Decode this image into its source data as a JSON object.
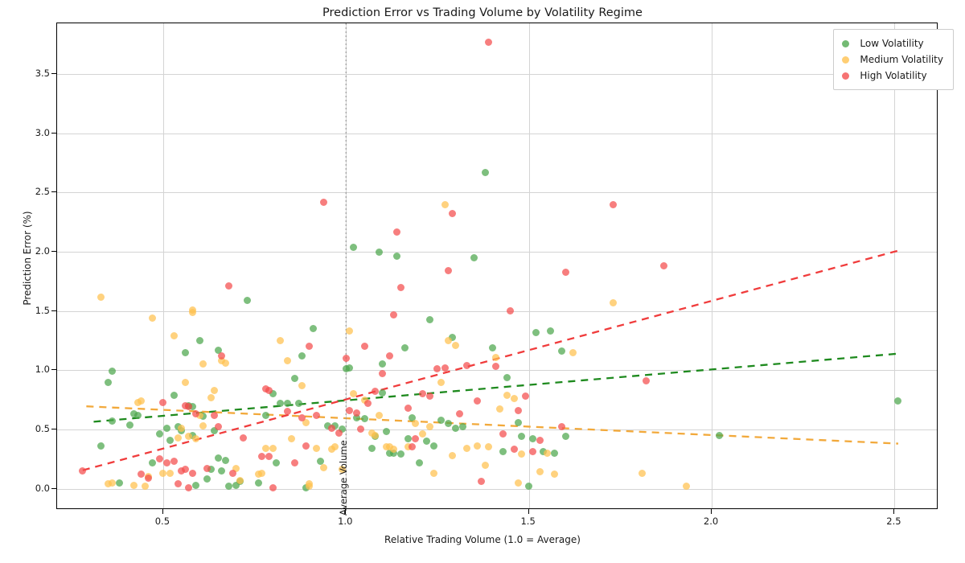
{
  "chart_data": {
    "type": "scatter",
    "title": "Prediction Error vs Trading Volume by Volatility Regime",
    "xlabel": "Relative Trading Volume (1.0 = Average)",
    "ylabel": "Prediction Error (%)",
    "xlim": [
      0.21,
      2.62
    ],
    "ylim": [
      -0.18,
      3.93
    ],
    "xticks": [
      0.5,
      1.0,
      1.5,
      2.0,
      2.5
    ],
    "xtick_labels": [
      "0.5",
      "1.0",
      "1.5",
      "2.0",
      "2.5"
    ],
    "yticks": [
      0.0,
      0.5,
      1.0,
      1.5,
      2.0,
      2.5,
      3.0,
      3.5
    ],
    "ytick_labels": [
      "0.0",
      "0.5",
      "1.0",
      "1.5",
      "2.0",
      "2.5",
      "3.0",
      "3.5"
    ],
    "grid": true,
    "legend_position": "upper right",
    "marker_opacity": 0.72,
    "annotations": [
      {
        "name": "average-volume-line",
        "text": "Average Volume",
        "x": 1.0,
        "style": "vertical dashed",
        "color": "#999999"
      }
    ],
    "colors": {
      "low": "#4CA64C",
      "medium": "#FFC04D",
      "high": "#F44C4C"
    },
    "trend_colors": {
      "low": "#1E8A1E",
      "medium": "#F2A93B",
      "high": "#F03C3C"
    },
    "series": [
      {
        "name": "Low Volatility",
        "color": "#4CA64C",
        "trendline": {
          "x": [
            0.31,
            2.51
          ],
          "y": [
            0.565,
            1.14
          ],
          "style": "dashed",
          "color": "#1E8A1E"
        },
        "points": [
          [
            0.33,
            0.36
          ],
          [
            0.35,
            0.9
          ],
          [
            0.36,
            0.99
          ],
          [
            0.36,
            0.57
          ],
          [
            0.38,
            0.05
          ],
          [
            0.41,
            0.54
          ],
          [
            0.42,
            0.63
          ],
          [
            0.43,
            0.62
          ],
          [
            0.47,
            0.22
          ],
          [
            0.49,
            0.46
          ],
          [
            0.51,
            0.51
          ],
          [
            0.52,
            0.41
          ],
          [
            0.53,
            0.79
          ],
          [
            0.54,
            0.52
          ],
          [
            0.55,
            0.49
          ],
          [
            0.56,
            1.15
          ],
          [
            0.57,
            0.7
          ],
          [
            0.58,
            0.69
          ],
          [
            0.58,
            0.45
          ],
          [
            0.59,
            0.03
          ],
          [
            0.6,
            1.25
          ],
          [
            0.61,
            0.61
          ],
          [
            0.62,
            0.08
          ],
          [
            0.63,
            0.16
          ],
          [
            0.64,
            0.49
          ],
          [
            0.65,
            1.17
          ],
          [
            0.65,
            0.26
          ],
          [
            0.66,
            0.15
          ],
          [
            0.67,
            0.24
          ],
          [
            0.68,
            0.02
          ],
          [
            0.7,
            0.03
          ],
          [
            0.71,
            0.06
          ],
          [
            0.73,
            1.59
          ],
          [
            0.76,
            0.05
          ],
          [
            0.78,
            0.62
          ],
          [
            0.8,
            0.8
          ],
          [
            0.81,
            0.22
          ],
          [
            0.82,
            0.72
          ],
          [
            0.84,
            0.72
          ],
          [
            0.86,
            0.93
          ],
          [
            0.87,
            0.72
          ],
          [
            0.88,
            1.12
          ],
          [
            0.89,
            0.01
          ],
          [
            0.91,
            1.35
          ],
          [
            0.93,
            0.23
          ],
          [
            0.95,
            0.53
          ],
          [
            0.97,
            0.53
          ],
          [
            0.99,
            0.5
          ],
          [
            1.0,
            1.01
          ],
          [
            1.01,
            1.02
          ],
          [
            1.02,
            2.04
          ],
          [
            1.03,
            0.6
          ],
          [
            1.05,
            0.59
          ],
          [
            1.07,
            0.34
          ],
          [
            1.08,
            0.44
          ],
          [
            1.09,
            2.0
          ],
          [
            1.1,
            1.05
          ],
          [
            1.1,
            0.81
          ],
          [
            1.11,
            0.48
          ],
          [
            1.12,
            0.3
          ],
          [
            1.13,
            0.3
          ],
          [
            1.14,
            1.96
          ],
          [
            1.15,
            0.29
          ],
          [
            1.16,
            1.19
          ],
          [
            1.17,
            0.42
          ],
          [
            1.18,
            0.6
          ],
          [
            1.2,
            0.22
          ],
          [
            1.22,
            0.4
          ],
          [
            1.23,
            1.43
          ],
          [
            1.24,
            0.36
          ],
          [
            1.26,
            0.58
          ],
          [
            1.28,
            0.55
          ],
          [
            1.29,
            1.28
          ],
          [
            1.3,
            0.51
          ],
          [
            1.32,
            0.52
          ],
          [
            1.35,
            1.95
          ],
          [
            1.38,
            2.67
          ],
          [
            1.4,
            1.19
          ],
          [
            1.43,
            0.31
          ],
          [
            1.44,
            0.94
          ],
          [
            1.47,
            0.56
          ],
          [
            1.48,
            0.44
          ],
          [
            1.5,
            0.02
          ],
          [
            1.51,
            0.42
          ],
          [
            1.52,
            1.32
          ],
          [
            1.54,
            0.31
          ],
          [
            1.56,
            1.33
          ],
          [
            1.57,
            0.3
          ],
          [
            1.59,
            1.16
          ],
          [
            1.6,
            0.44
          ],
          [
            2.02,
            0.45
          ],
          [
            2.51,
            0.74
          ]
        ]
      },
      {
        "name": "Medium Volatility",
        "color": "#FFC04D",
        "trendline": {
          "x": [
            0.29,
            2.51
          ],
          "y": [
            0.695,
            0.38
          ],
          "style": "dashed",
          "color": "#F2A93B"
        },
        "points": [
          [
            0.33,
            1.62
          ],
          [
            0.35,
            0.04
          ],
          [
            0.36,
            0.05
          ],
          [
            0.42,
            0.03
          ],
          [
            0.43,
            0.73
          ],
          [
            0.44,
            0.74
          ],
          [
            0.45,
            0.02
          ],
          [
            0.46,
            0.1
          ],
          [
            0.47,
            1.44
          ],
          [
            0.5,
            0.13
          ],
          [
            0.52,
            0.13
          ],
          [
            0.53,
            1.29
          ],
          [
            0.54,
            0.43
          ],
          [
            0.55,
            0.51
          ],
          [
            0.56,
            0.9
          ],
          [
            0.57,
            0.44
          ],
          [
            0.58,
            1.51
          ],
          [
            0.58,
            1.49
          ],
          [
            0.59,
            0.42
          ],
          [
            0.6,
            0.62
          ],
          [
            0.61,
            1.05
          ],
          [
            0.61,
            0.53
          ],
          [
            0.63,
            0.77
          ],
          [
            0.64,
            0.83
          ],
          [
            0.66,
            1.08
          ],
          [
            0.67,
            1.06
          ],
          [
            0.7,
            0.17
          ],
          [
            0.71,
            0.07
          ],
          [
            0.76,
            0.12
          ],
          [
            0.77,
            0.13
          ],
          [
            0.78,
            0.34
          ],
          [
            0.8,
            0.34
          ],
          [
            0.82,
            1.25
          ],
          [
            0.84,
            1.08
          ],
          [
            0.85,
            0.42
          ],
          [
            0.88,
            0.87
          ],
          [
            0.89,
            0.56
          ],
          [
            0.9,
            0.02
          ],
          [
            0.9,
            0.04
          ],
          [
            0.92,
            0.34
          ],
          [
            0.94,
            0.18
          ],
          [
            0.96,
            0.33
          ],
          [
            0.97,
            0.35
          ],
          [
            0.99,
            0.16
          ],
          [
            1.01,
            1.33
          ],
          [
            1.02,
            0.8
          ],
          [
            1.05,
            0.75
          ],
          [
            1.07,
            0.47
          ],
          [
            1.08,
            0.45
          ],
          [
            1.09,
            0.62
          ],
          [
            1.11,
            0.35
          ],
          [
            1.12,
            0.35
          ],
          [
            1.13,
            0.33
          ],
          [
            1.17,
            0.35
          ],
          [
            1.19,
            0.55
          ],
          [
            1.21,
            0.46
          ],
          [
            1.23,
            0.52
          ],
          [
            1.24,
            0.13
          ],
          [
            1.26,
            0.9
          ],
          [
            1.27,
            2.4
          ],
          [
            1.28,
            1.25
          ],
          [
            1.29,
            0.28
          ],
          [
            1.3,
            1.21
          ],
          [
            1.33,
            0.34
          ],
          [
            1.36,
            0.36
          ],
          [
            1.38,
            0.2
          ],
          [
            1.39,
            0.35
          ],
          [
            1.41,
            1.11
          ],
          [
            1.42,
            0.67
          ],
          [
            1.44,
            0.79
          ],
          [
            1.46,
            0.76
          ],
          [
            1.47,
            0.05
          ],
          [
            1.48,
            0.29
          ],
          [
            1.53,
            0.14
          ],
          [
            1.55,
            0.3
          ],
          [
            1.57,
            0.12
          ],
          [
            1.62,
            1.15
          ],
          [
            1.73,
            1.57
          ],
          [
            1.81,
            0.13
          ],
          [
            1.93,
            0.02
          ]
        ]
      },
      {
        "name": "High Volatility",
        "color": "#F44C4C",
        "trendline": {
          "x": [
            0.28,
            2.51
          ],
          "y": [
            0.155,
            2.01
          ],
          "style": "dashed",
          "color": "#F03C3C"
        },
        "points": [
          [
            0.28,
            0.15
          ],
          [
            0.44,
            0.12
          ],
          [
            0.46,
            0.09
          ],
          [
            0.49,
            0.25
          ],
          [
            0.5,
            0.73
          ],
          [
            0.51,
            0.22
          ],
          [
            0.53,
            0.23
          ],
          [
            0.54,
            0.04
          ],
          [
            0.55,
            0.15
          ],
          [
            0.56,
            0.16
          ],
          [
            0.56,
            0.7
          ],
          [
            0.57,
            0.01
          ],
          [
            0.57,
            0.69
          ],
          [
            0.58,
            0.13
          ],
          [
            0.62,
            0.17
          ],
          [
            0.65,
            0.52
          ],
          [
            0.66,
            1.12
          ],
          [
            0.68,
            1.71
          ],
          [
            0.69,
            0.13
          ],
          [
            0.72,
            0.43
          ],
          [
            0.77,
            0.27
          ],
          [
            0.78,
            0.84
          ],
          [
            0.79,
            0.83
          ],
          [
            0.79,
            0.27
          ],
          [
            0.8,
            0.01
          ],
          [
            0.84,
            0.65
          ],
          [
            0.86,
            0.22
          ],
          [
            0.88,
            0.6
          ],
          [
            0.89,
            0.36
          ],
          [
            0.9,
            1.2
          ],
          [
            0.92,
            0.62
          ],
          [
            0.94,
            2.42
          ],
          [
            0.96,
            0.51
          ],
          [
            0.98,
            0.47
          ],
          [
            1.0,
            1.1
          ],
          [
            1.01,
            0.66
          ],
          [
            1.03,
            0.64
          ],
          [
            1.05,
            1.2
          ],
          [
            1.06,
            0.72
          ],
          [
            1.08,
            0.82
          ],
          [
            1.1,
            0.97
          ],
          [
            1.12,
            1.12
          ],
          [
            1.13,
            1.47
          ],
          [
            1.15,
            1.7
          ],
          [
            1.17,
            0.68
          ],
          [
            1.19,
            0.42
          ],
          [
            1.21,
            0.8
          ],
          [
            1.23,
            0.78
          ],
          [
            1.25,
            1.01
          ],
          [
            1.27,
            1.02
          ],
          [
            1.28,
            1.84
          ],
          [
            1.29,
            2.32
          ],
          [
            1.31,
            0.63
          ],
          [
            1.33,
            1.04
          ],
          [
            1.36,
            0.74
          ],
          [
            1.37,
            0.06
          ],
          [
            1.39,
            3.77
          ],
          [
            1.41,
            1.03
          ],
          [
            1.43,
            0.46
          ],
          [
            1.45,
            1.5
          ],
          [
            1.46,
            0.33
          ],
          [
            1.47,
            0.66
          ],
          [
            1.49,
            0.78
          ],
          [
            1.51,
            0.31
          ],
          [
            1.53,
            0.41
          ],
          [
            1.59,
            0.52
          ],
          [
            1.6,
            1.83
          ],
          [
            1.73,
            2.4
          ],
          [
            1.82,
            0.91
          ],
          [
            1.87,
            1.88
          ],
          [
            1.14,
            2.17
          ],
          [
            0.59,
            0.63
          ],
          [
            0.64,
            0.62
          ],
          [
            1.04,
            0.5
          ],
          [
            1.18,
            0.35
          ]
        ]
      }
    ]
  },
  "legend": {
    "entries": [
      {
        "label": "Low Volatility",
        "color": "#4CA64C"
      },
      {
        "label": "Medium Volatility",
        "color": "#FFC04D"
      },
      {
        "label": "High Volatility",
        "color": "#F44C4C"
      }
    ]
  }
}
